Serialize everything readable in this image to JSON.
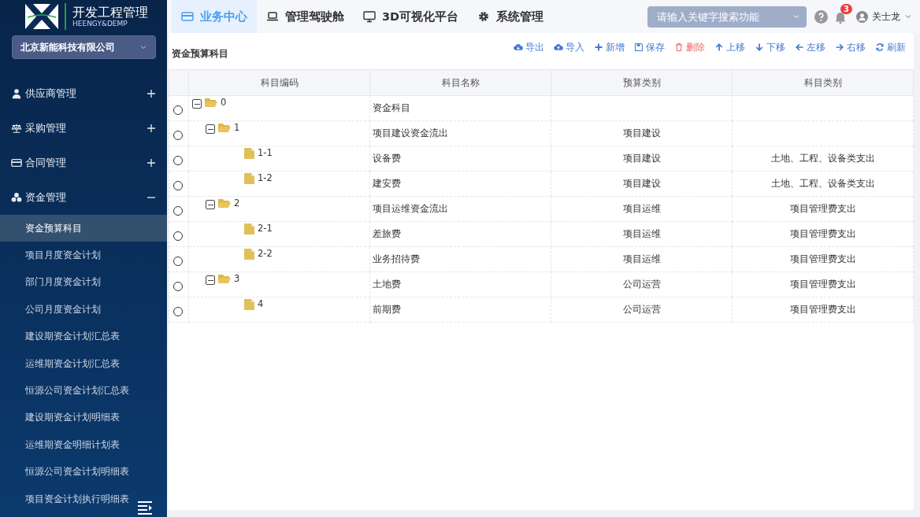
{
  "brand": {
    "title": "开发工程管理",
    "subtitle": "HEENGY&DEMP"
  },
  "company_select": {
    "value": "北京新能科技有限公司"
  },
  "sidebar": {
    "groups": [
      {
        "label": "供应商管理",
        "expanded": false
      },
      {
        "label": "采购管理",
        "expanded": false
      },
      {
        "label": "合同管理",
        "expanded": false
      },
      {
        "label": "资金管理",
        "expanded": true,
        "children": [
          {
            "label": "资金预算科目",
            "selected": true
          },
          {
            "label": "项目月度资金计划",
            "selected": false
          },
          {
            "label": "部门月度资金计划",
            "selected": false
          },
          {
            "label": "公司月度资金计划",
            "selected": false
          },
          {
            "label": "建设期资金计划汇总表",
            "selected": false
          },
          {
            "label": "运维期资金计划汇总表",
            "selected": false
          },
          {
            "label": "恒源公司资金计划汇总表",
            "selected": false
          },
          {
            "label": "建设期资金计划明细表",
            "selected": false
          },
          {
            "label": "运维期资金明细计划表",
            "selected": false
          },
          {
            "label": "恒源公司资金计划明细表",
            "selected": false
          },
          {
            "label": "项目资金计划执行明细表",
            "selected": false
          }
        ]
      }
    ]
  },
  "top_tabs": [
    {
      "label": "业务中心",
      "selected": true
    },
    {
      "label": "管理驾驶舱",
      "selected": false
    },
    {
      "label": "3D可视化平台",
      "selected": false
    },
    {
      "label": "系统管理",
      "selected": false
    }
  ],
  "search": {
    "placeholder": "请输入关键字搜索功能"
  },
  "notifications": {
    "count": "3"
  },
  "user": {
    "name": "关士龙"
  },
  "panel": {
    "title": "资金预算科目"
  },
  "toolbar": [
    {
      "label": "导出",
      "kind": "normal"
    },
    {
      "label": "导入",
      "kind": "normal"
    },
    {
      "label": "新增",
      "kind": "normal"
    },
    {
      "label": "保存",
      "kind": "normal"
    },
    {
      "label": "删除",
      "kind": "danger"
    },
    {
      "label": "上移",
      "kind": "normal"
    },
    {
      "label": "下移",
      "kind": "normal"
    },
    {
      "label": "左移",
      "kind": "normal"
    },
    {
      "label": "右移",
      "kind": "normal"
    },
    {
      "label": "刷新",
      "kind": "normal"
    }
  ],
  "table": {
    "columns": [
      "科目编码",
      "科目名称",
      "预算类别",
      "科目类别"
    ],
    "rows": [
      {
        "code": "0",
        "name": "资金科目",
        "selected": false,
        "expanded": true,
        "children": [
          {
            "code": "1",
            "name": "项目建设资金流出",
            "budget_type": "项目建设",
            "selected": false,
            "expanded": true,
            "children": [
              {
                "code": "1-1",
                "name": "设备费",
                "budget_type": "项目建设",
                "subject_type": "土地、工程、设备类支出",
                "selected": false
              },
              {
                "code": "1-2",
                "name": "建安费",
                "budget_type": "项目建设",
                "subject_type": "土地、工程、设备类支出",
                "selected": false
              }
            ]
          },
          {
            "code": "2",
            "name": "项目运维资金流出",
            "budget_type": "项目运维",
            "subject_type": "项目管理费支出",
            "selected": false,
            "expanded": true,
            "children": [
              {
                "code": "2-1",
                "name": "差旅费",
                "budget_type": "项目运维",
                "subject_type": "项目管理费支出",
                "selected": false
              },
              {
                "code": "2-2",
                "name": "业务招待费",
                "budget_type": "项目运维",
                "subject_type": "项目管理费支出",
                "selected": false
              }
            ]
          },
          {
            "code": "3",
            "name": "土地费",
            "budget_type": "公司运营",
            "subject_type": "项目管理费支出",
            "selected": false,
            "expanded": true,
            "children": [
              {
                "code": "4",
                "name": "前期费",
                "budget_type": "公司运营",
                "subject_type": "项目管理费支出",
                "selected": false
              }
            ]
          }
        ]
      }
    ]
  }
}
